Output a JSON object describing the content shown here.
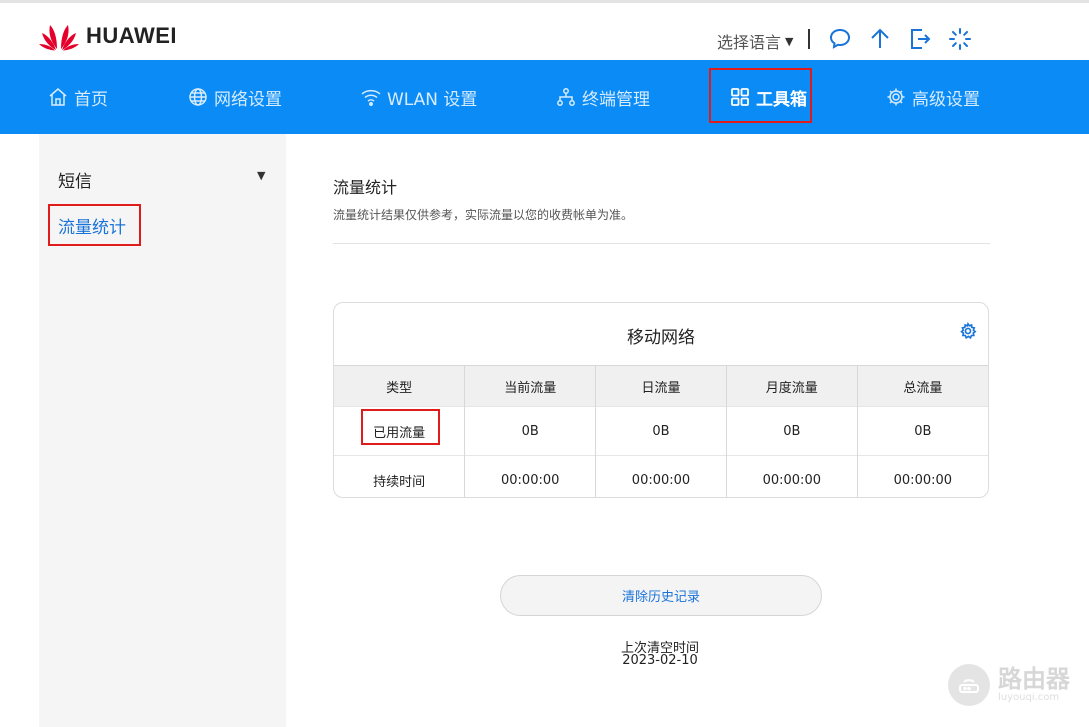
{
  "header": {
    "brand": "HUAWEI",
    "language_label": "选择语言",
    "icons": [
      "message-icon",
      "upload-icon",
      "logout-icon",
      "loading-icon"
    ]
  },
  "nav": {
    "items": [
      {
        "label": "首页",
        "icon": "home-icon"
      },
      {
        "label": "网络设置",
        "icon": "globe-icon"
      },
      {
        "label": "WLAN 设置",
        "icon": "wifi-icon"
      },
      {
        "label": "终端管理",
        "icon": "devices-icon"
      },
      {
        "label": "工具箱",
        "icon": "grid-icon",
        "active": true
      },
      {
        "label": "高级设置",
        "icon": "gear-icon"
      }
    ]
  },
  "sidebar": {
    "group": "短信",
    "active_item": "流量统计"
  },
  "main": {
    "title": "流量统计",
    "description": "流量统计结果仅供参考，实际流量以您的收费帐单为准。",
    "card": {
      "title": "移动网络",
      "columns": [
        "类型",
        "当前流量",
        "日流量",
        "月度流量",
        "总流量"
      ],
      "rows": [
        [
          "已用流量",
          "0B",
          "0B",
          "0B",
          "0B"
        ],
        [
          "持续时间",
          "00:00:00",
          "00:00:00",
          "00:00:00",
          "00:00:00"
        ]
      ]
    },
    "clear_button": "清除历史记录",
    "last_cleared_label": "上次清空时间",
    "last_cleared_date": "2023-02-10"
  },
  "watermark": {
    "text": "路由器",
    "sub": "luyouqi.com"
  },
  "colors": {
    "nav_bg": "#0a8bf5",
    "accent": "#1a73d9",
    "brand_red": "#e4002b",
    "highlight": "#e01b1b"
  }
}
